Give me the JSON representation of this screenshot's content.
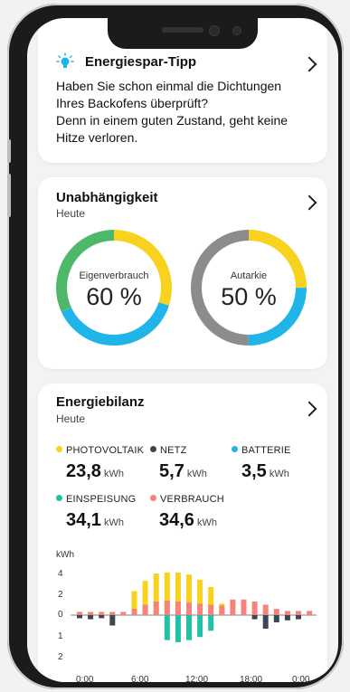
{
  "colors": {
    "yellow": "#f8d21e",
    "blue": "#1fb5e8",
    "green": "#4db86a",
    "gray": "#8c8c8c",
    "teal": "#22c1a6",
    "salmon": "#f4837d",
    "dark": "#3d4752"
  },
  "tip": {
    "icon": "lightbulb-icon",
    "title": "Energiespar-Tipp",
    "line1": "Haben Sie schon einmal die Dichtungen",
    "line2": "Ihres Backofens überprüft?",
    "line3": "Denn in einem guten Zustand, geht keine",
    "line4": "Hitze verloren."
  },
  "independence": {
    "title": "Unabhängigkeit",
    "subtitle": "Heute",
    "left": {
      "label": "Eigenverbrauch",
      "value": "60 %",
      "fraction": 0.6
    },
    "right": {
      "label": "Autarkie",
      "value": "50 %",
      "fraction": 0.5
    }
  },
  "balance": {
    "title": "Energiebilanz",
    "subtitle": "Heute",
    "items": [
      {
        "label": "PHOTOVOLTAIK",
        "value": "23,8",
        "unit": "kWh",
        "color": "#f8d21e"
      },
      {
        "label": "NETZ",
        "value": "5,7",
        "unit": "kWh",
        "color": "#3d4752"
      },
      {
        "label": "BATTERIE",
        "value": "3,5",
        "unit": "kWh",
        "color": "#1fb5e8"
      },
      {
        "label": "EINSPEISUNG",
        "value": "34,1",
        "unit": "kWh",
        "color": "#22c1a6"
      },
      {
        "label": "VERBRAUCH",
        "value": "34,6",
        "unit": "kWh",
        "color": "#f4837d"
      }
    ]
  },
  "chart_data": {
    "type": "bar",
    "ylabel": "kWh",
    "y_ticks_above": [
      "4",
      "2",
      "0"
    ],
    "y_ticks_below": [
      "1",
      "2"
    ],
    "x_ticks": [
      "0:00",
      "6:00",
      "12:00",
      "18:00",
      "0:00"
    ],
    "x": [
      0,
      1,
      2,
      3,
      4,
      5,
      6,
      7,
      8,
      9,
      10,
      11,
      12,
      13,
      14,
      15,
      16,
      17,
      18,
      19,
      20,
      21
    ],
    "series": [
      {
        "name": "PHOTOVOLTAIK",
        "values": [
          0,
          0,
          0,
          0,
          0.2,
          2.3,
          3.3,
          4.0,
          4.1,
          4.1,
          3.9,
          3.4,
          2.7,
          1.1,
          0.2,
          0,
          0,
          0,
          0,
          0,
          0,
          0
        ]
      },
      {
        "name": "VERBRAUCH",
        "values": [
          0.3,
          0.3,
          0.3,
          0.3,
          0.3,
          0.6,
          1.0,
          1.3,
          1.4,
          1.3,
          1.2,
          1.1,
          1.0,
          0.9,
          1.5,
          1.5,
          1.3,
          1.0,
          0.6,
          0.4,
          0.4,
          0.4
        ]
      },
      {
        "name": "NETZ",
        "values": [
          -0.3,
          -0.4,
          -0.3,
          -1.0,
          0,
          0,
          0,
          0,
          0,
          0,
          0,
          0,
          0,
          0,
          0,
          0,
          -0.4,
          -1.3,
          -0.7,
          -0.5,
          -0.4,
          0
        ]
      },
      {
        "name": "EINSPEISUNG",
        "values": [
          0,
          0,
          0,
          0,
          0,
          0,
          0,
          0,
          -2.4,
          -2.6,
          -2.4,
          -2.1,
          -1.5,
          0,
          0,
          0,
          0,
          0,
          0,
          0,
          0,
          0
        ]
      }
    ]
  }
}
